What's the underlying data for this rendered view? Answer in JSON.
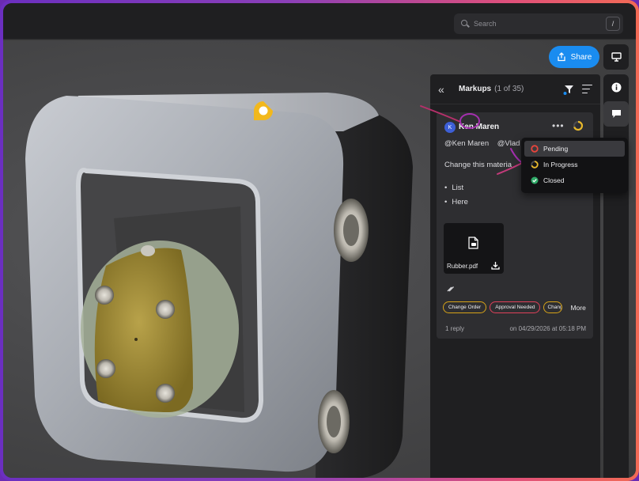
{
  "topbar": {
    "search_placeholder": "Search",
    "shortcut_key": "/"
  },
  "toolbar": {
    "share_label": "Share"
  },
  "markups": {
    "title": "Markups",
    "count": "(1 of 35)",
    "card": {
      "avatar_initial": "K",
      "author": "Ken Maren",
      "mentions": [
        "@Ken Maren",
        "@Vlad P"
      ],
      "text": "Change this materia",
      "bullets": [
        "List",
        "Here"
      ],
      "attachment_name": "Rubber.pdf",
      "tags": [
        "Change Order",
        "Approval Needed",
        "Change"
      ],
      "more_label": "More",
      "reply_count": "1 reply",
      "date": "on 04/29/2026 at 05:18 PM"
    }
  },
  "status_menu": {
    "items": [
      {
        "label": "Pending",
        "color": "#e8453c"
      },
      {
        "label": "In Progress",
        "color": "#e8b82a"
      },
      {
        "label": "Closed",
        "color": "#2faa68"
      }
    ]
  },
  "colors": {
    "accent": "#1a8cf0",
    "pin": "#f2b81c",
    "annotation": "#a52fb0"
  }
}
